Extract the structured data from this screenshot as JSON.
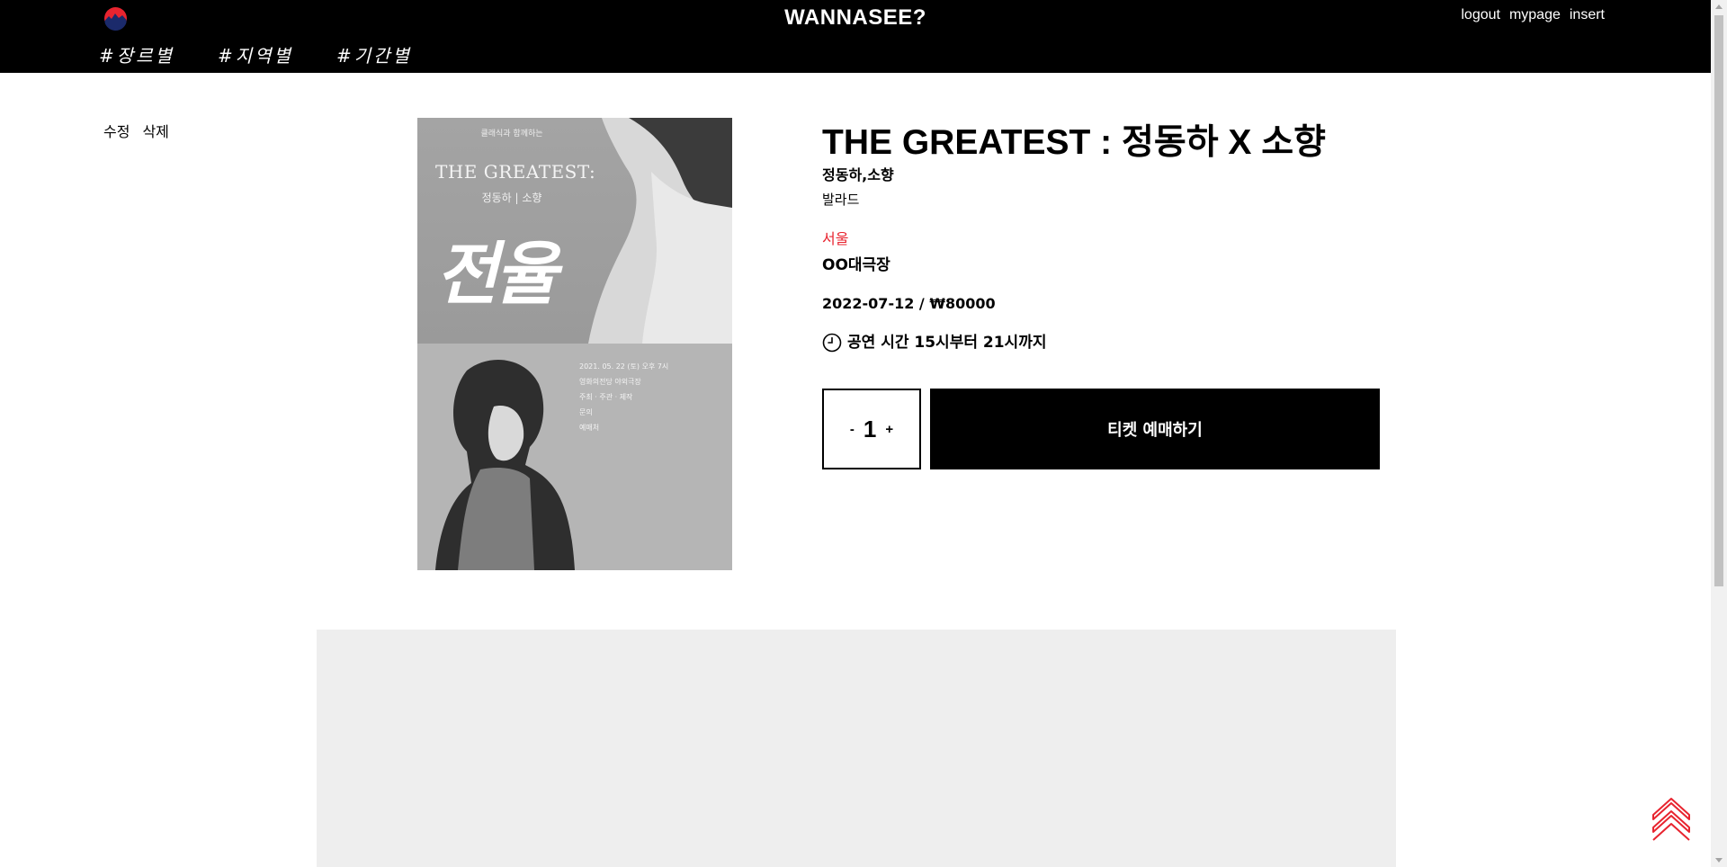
{
  "header": {
    "logo_icon": "mountain-sunset-logo",
    "site_title": "WANNASEE?",
    "links": {
      "logout": "logout",
      "mypage": "mypage",
      "insert": "insert"
    },
    "nav": [
      "#장르별",
      "#지역별",
      "#기간별"
    ]
  },
  "admin": {
    "edit": "수정",
    "delete": "삭제"
  },
  "poster": {
    "subtitle": "클래식과 함께하는",
    "title": "THE GREATEST:",
    "names": "정동하 | 소향",
    "calligraphy": "전율",
    "info": [
      "2021. 05. 22 (토) 오후 7시",
      "영화의전당 야외극장",
      "주최 · 주관 · 제작",
      "문의",
      "예매처"
    ]
  },
  "detail": {
    "title": "THE GREATEST : 정동하 X 소향",
    "artist": "정동하,소향",
    "genre": "발라드",
    "region": "서울",
    "venue": "OO대극장",
    "date_price": "2022-07-12 / ₩80000",
    "time_icon": "clock-icon",
    "time_text": "공연 시간 15시부터 21시까지"
  },
  "booking": {
    "minus": "-",
    "quantity": "1",
    "plus": "+",
    "book_label": "티켓 예매하기"
  },
  "scroll_top_icon": "double-chevron-up-icon",
  "colors": {
    "header_bg": "#000000",
    "region": "#e8242f",
    "panel_bg": "#eeeeee",
    "scroll_top": "#e8242f"
  }
}
